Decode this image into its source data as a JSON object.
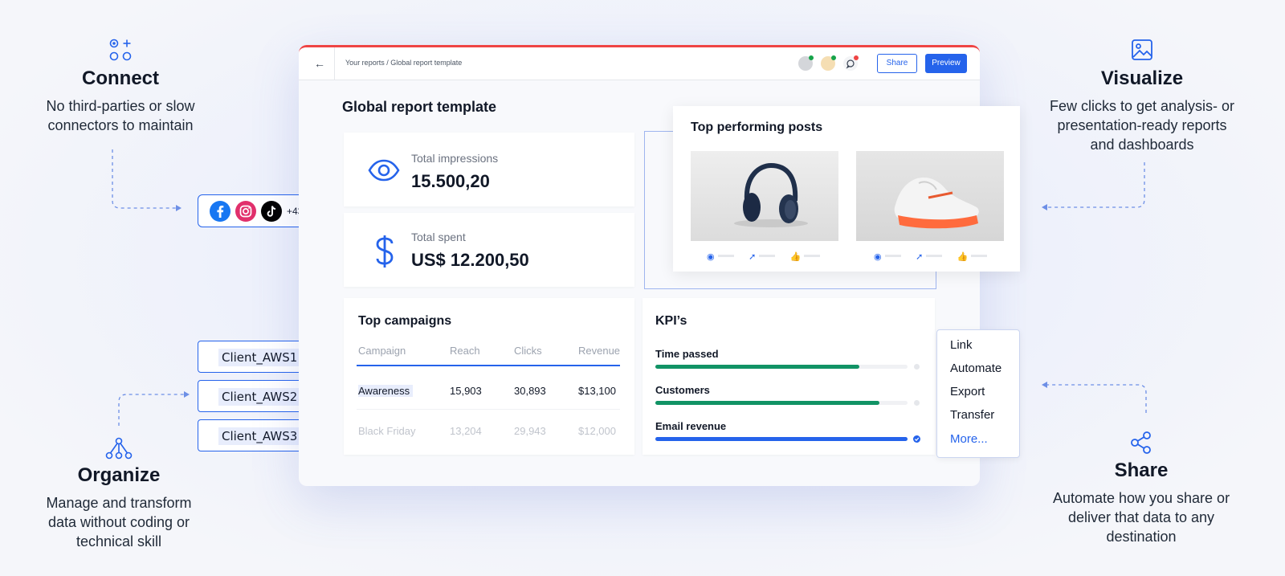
{
  "features": {
    "connect": {
      "title": "Connect",
      "line1": "No third-parties or slow",
      "line2": "connectors to maintain"
    },
    "visualize": {
      "title": "Visualize",
      "line1": "Few clicks to get analysis- or",
      "line2": "presentation-ready reports",
      "line3": "and dashboards"
    },
    "organize": {
      "title": "Organize",
      "line1": "Manage and transform",
      "line2": "data without coding or",
      "line3": "technical skill"
    },
    "share": {
      "title": "Share",
      "line1": "Automate how you share or",
      "line2": "deliver that data to any",
      "line3": "destination"
    }
  },
  "sources": {
    "more_count": "+43",
    "icons": [
      "facebook-icon",
      "instagram-icon",
      "tiktok-icon"
    ]
  },
  "clients": [
    "Client_AWS1",
    "Client_AWS2",
    "Client_AWS3"
  ],
  "toolbar": {
    "back_icon": "←",
    "breadcrumb": "Your reports / Global report template",
    "share_label": "Share",
    "preview_label": "Preview"
  },
  "report": {
    "title": "Global report template",
    "metrics": [
      {
        "label": "Total impressions",
        "value": "15.500,20",
        "icon": "eye-icon"
      },
      {
        "label": "Total spent",
        "value": "US$ 12.200,50",
        "icon": "dollar-icon"
      }
    ],
    "top_posts": {
      "title": "Top performing posts"
    },
    "campaigns": {
      "title": "Top campaigns",
      "headers": [
        "Campaign",
        "Reach",
        "Clicks",
        "Revenue"
      ],
      "rows": [
        [
          "Awareness",
          "15,903",
          "30,893",
          "$13,100"
        ],
        [
          "Black Friday",
          "13,204",
          "29,943",
          "$12,000"
        ]
      ]
    },
    "kpis": {
      "title": "KPI’s",
      "items": [
        {
          "label": "Time passed",
          "progress": 0.81,
          "color": "#119365"
        },
        {
          "label": "Customers",
          "progress": 0.89,
          "color": "#119365"
        },
        {
          "label": "Email revenue",
          "progress": 1.0,
          "color": "#2563eb"
        }
      ]
    }
  },
  "share_menu": [
    "Link",
    "Automate",
    "Export",
    "Transfer",
    "More..."
  ],
  "colors": {
    "accent": "#2563eb",
    "kpi_green": "#119365",
    "window_top": "#ef4444"
  }
}
